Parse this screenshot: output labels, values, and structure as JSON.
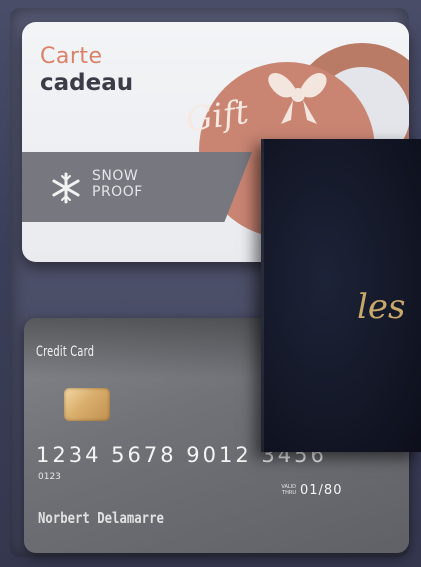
{
  "gift_card": {
    "title_line1": "Carte",
    "title_line2": "cadeau",
    "badge_line1": "SNOW",
    "badge_line2": "PROOF",
    "badge_icon": "snowflake-icon",
    "emblem_word": "Gift",
    "colors": {
      "accent": "#d9826a",
      "disc": "#c98472",
      "band": "#77787f"
    }
  },
  "credit_card": {
    "label": "Credit Card",
    "number": "1234  5678  9012  3456",
    "small_code": "0123",
    "valid_thru": "VALID THRU",
    "expiry": "01/80",
    "holder": "Norbert Delamarre",
    "chip_icon": "chip-icon"
  },
  "notebook": {
    "cover_text": "les",
    "colors": {
      "cover": "#141828",
      "lettering": "#c9a86a"
    }
  }
}
